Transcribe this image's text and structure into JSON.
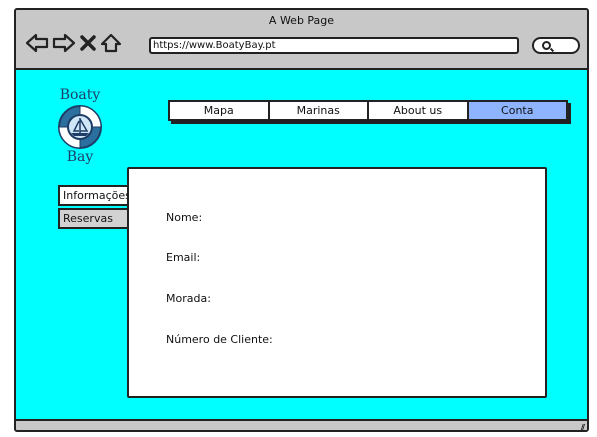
{
  "window": {
    "title": "A Web Page",
    "url": "https://www.BoatyBay.pt"
  },
  "icons": {
    "back": "arrow-left-icon",
    "forward": "arrow-right-icon",
    "stop": "close-icon",
    "home": "home-icon",
    "search": "search-icon"
  },
  "logo": {
    "top_text": "Boaty",
    "bottom_text": "Bay"
  },
  "menu": {
    "items": [
      {
        "label": "Mapa"
      },
      {
        "label": "Marinas"
      },
      {
        "label": "About us"
      },
      {
        "label": "Conta",
        "active": true
      }
    ]
  },
  "sidebar": {
    "tabs": [
      {
        "label": "Informações",
        "selected": true
      },
      {
        "label": "Reservas"
      }
    ]
  },
  "panel": {
    "fields": [
      {
        "label": "Nome:"
      },
      {
        "label": "Email:"
      },
      {
        "label": "Morada:"
      },
      {
        "label": "Número de Cliente:"
      }
    ]
  },
  "colors": {
    "content_bg": "#00ffff",
    "active_menu": "#8fb4ff",
    "chrome": "#c8c8c8",
    "logo_navy": "#1e3d66"
  }
}
